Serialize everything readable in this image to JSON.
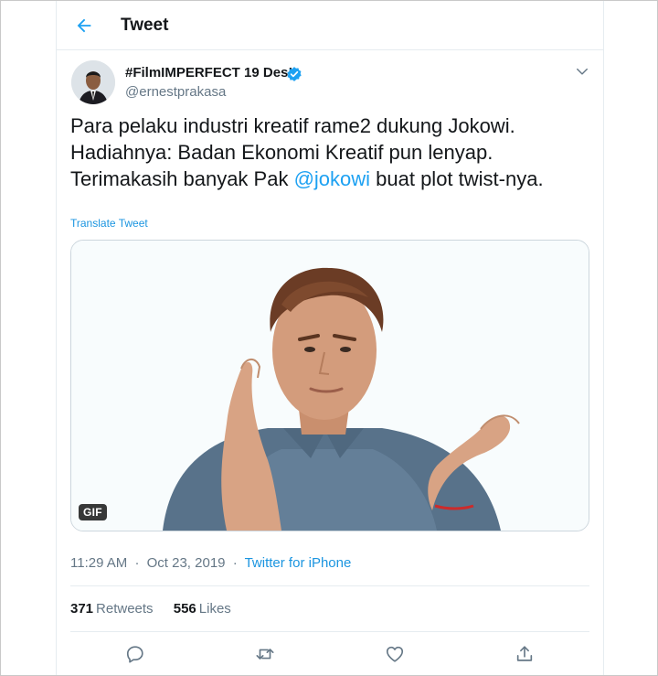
{
  "header": {
    "title": "Tweet",
    "back_icon": "arrow-left-icon"
  },
  "author": {
    "display_name": "#FilmIMPERFECT 19 Des!",
    "handle": "@ernestprakasa",
    "verified": true
  },
  "tweet": {
    "line1": "Para pelaku industri kreatif rame2 dukung Jokowi.",
    "line2": "Hadiahnya: Badan Ekonomi Kreatif pun lenyap.",
    "line3_before": "Terimakasih banyak Pak ",
    "mention": "@jokowi",
    "line3_after": " buat plot twist-nya.",
    "translate_label": "Translate Tweet"
  },
  "media": {
    "badge": "GIF"
  },
  "meta": {
    "time": "11:29 AM",
    "separator": "·",
    "date": "Oct 23, 2019",
    "source": "Twitter for iPhone"
  },
  "stats": {
    "retweets_count": "371",
    "retweets_label": "Retweets",
    "likes_count": "556",
    "likes_label": "Likes"
  },
  "actions": [
    "reply-icon",
    "retweet-icon",
    "like-icon",
    "share-icon"
  ],
  "colors": {
    "accent": "#1da1f2",
    "text": "#14171a",
    "muted": "#657786",
    "border": "#e6ecf0"
  }
}
